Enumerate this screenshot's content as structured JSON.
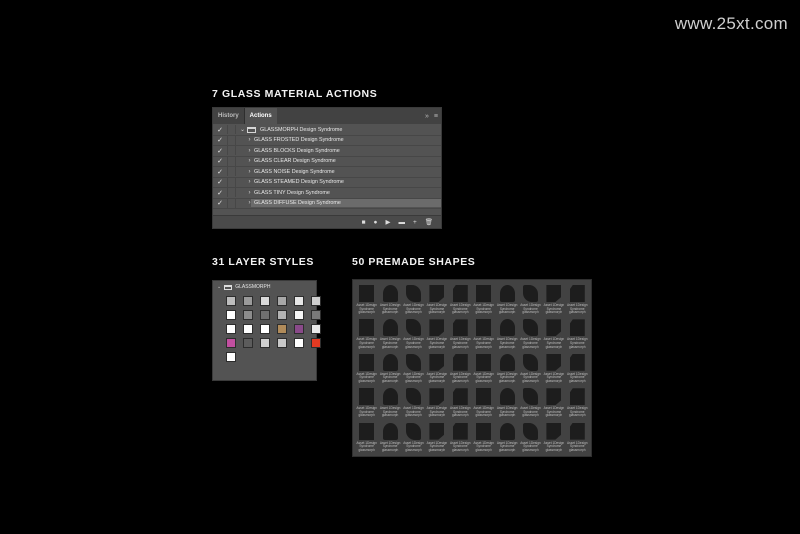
{
  "watermark": "www.25xt.com",
  "sections": {
    "actions_title": "7 GLASS MATERIAL ACTIONS",
    "styles_title": "31 LAYER STYLES",
    "shapes_title": "50 PREMADE SHAPES"
  },
  "actions_panel": {
    "tabs": [
      {
        "label": "History",
        "active": false
      },
      {
        "label": "Actions",
        "active": true
      }
    ],
    "tab_tools": {
      "expand": "»",
      "menu": "≡"
    },
    "set": {
      "label": "GLASSMORPH  Design Syndrome"
    },
    "items": [
      {
        "label": "GLASS FROSTED Design Syndrome"
      },
      {
        "label": "GLASS BLOCKS  Design Syndrome"
      },
      {
        "label": "GLASS CLEAR  Design Syndrome"
      },
      {
        "label": "GLASS NOISE Design Syndrome"
      },
      {
        "label": "GLASS STEAMED Design Syndrome"
      },
      {
        "label": "GLASS TINY  Design Syndrome"
      },
      {
        "label": "GLASS DIFFUSE  Design Syndrome"
      }
    ],
    "check_glyph": "✓",
    "chevron_right": "›",
    "chevron_down": "⌄",
    "footer": {
      "stop": "■",
      "record": "●",
      "play": "▶",
      "new_set": "▬",
      "new_action": "+",
      "delete": "🗑"
    }
  },
  "styles_panel": {
    "group_label": "GLASSMORPH",
    "swatches": [
      "#bdbdbd",
      "#9a9a9a",
      "#d9d9d9",
      "#a8a8a8",
      "#e6e6e6",
      "#cfcfcf",
      "#ffffff",
      "#8c8c8c",
      "#6f6f6f",
      "#b3b3b3",
      "#f5f5f5",
      "#7a7a7a",
      "#ffffff",
      "#ffffff",
      "#ffffff",
      "#b08b5a",
      "#8a4a8a",
      "#e8e8e8",
      "#c24fa0",
      "#5c5c5c",
      "#d0d0d0",
      "#c9c9c9",
      "#ffffff",
      "#e23a22",
      "#ffffff"
    ]
  },
  "shapes_panel": {
    "caption": "Asset 1Design Syndrome glassmorph",
    "cell_count": 50
  }
}
